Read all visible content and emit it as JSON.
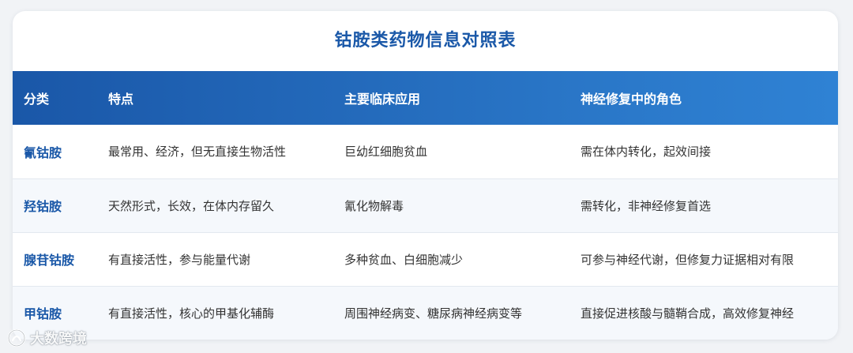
{
  "title": "钴胺类药物信息对照表",
  "table": {
    "headers": [
      "分类",
      "特点",
      "主要临床应用",
      "神经修复中的角色"
    ],
    "rows": [
      [
        "氰钴胺",
        "最常用、经济，但无直接生物活性",
        "巨幼红细胞贫血",
        "需在体内转化，起效间接"
      ],
      [
        "羟钴胺",
        "天然形式，长效，在体内存留久",
        "氰化物解毒",
        "需转化，非神经修复首选"
      ],
      [
        "腺苷钴胺",
        "有直接活性，参与能量代谢",
        "多种贫血、白细胞减少",
        "可参与神经代谢，但修复力证据相对有限"
      ],
      [
        "甲钴胺",
        "有直接活性，核心的甲基化辅酶",
        "周围神经病变、糖尿病神经病变等",
        "直接促进核酸与髓鞘合成，高效修复神经"
      ]
    ]
  },
  "watermark": {
    "text": "大数跨境",
    "icon": "brand-logo-icon"
  },
  "colors": {
    "accent": "#1a58a8",
    "header_gradient_start": "#1a57a8",
    "header_gradient_end": "#2f82d4"
  }
}
